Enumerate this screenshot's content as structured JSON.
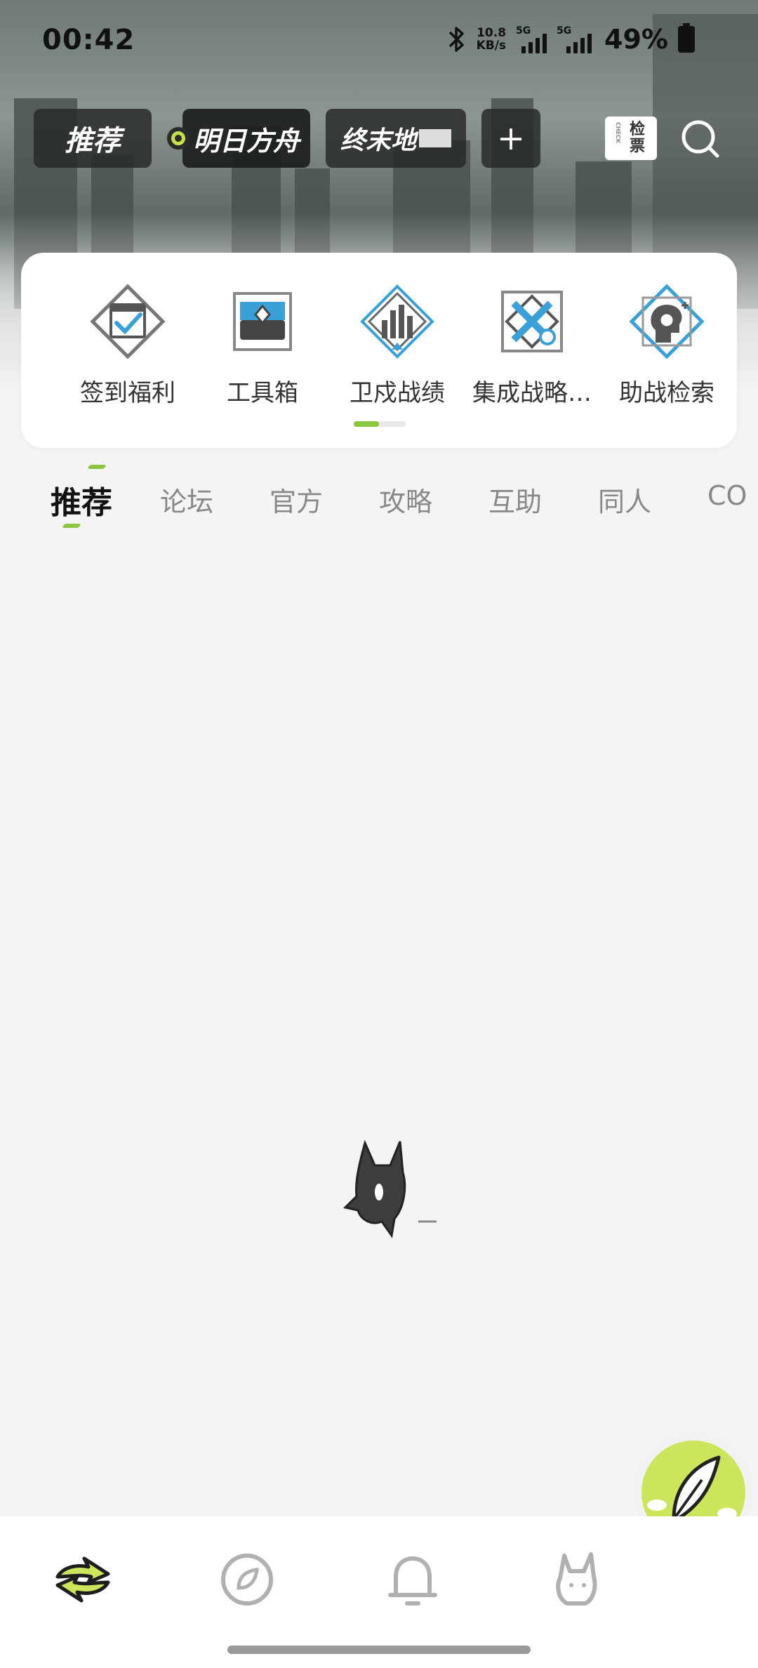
{
  "status_bar": {
    "time": "00:42",
    "net_speed_value": "10.8",
    "net_speed_unit": "KB/s",
    "sim1_tag": "5G",
    "sim2_tag": "5G",
    "battery_percent": "49%"
  },
  "game_tabs": {
    "recommend": "推荐",
    "arknights": "明日方舟",
    "endfield": "终末地",
    "add": "+"
  },
  "ticket": {
    "side_text": "CHECK",
    "label": "检票"
  },
  "tools": [
    {
      "label": "签到福利",
      "icon": "checkin-icon"
    },
    {
      "label": "工具箱",
      "icon": "toolbox-icon"
    },
    {
      "label": "卫戍战绩",
      "icon": "stats-icon"
    },
    {
      "label": "集成战略…",
      "icon": "strategy-icon"
    },
    {
      "label": "助战检索",
      "icon": "support-search-icon"
    }
  ],
  "categories": [
    "推荐",
    "论坛",
    "官方",
    "攻略",
    "互助",
    "同人",
    "CO"
  ],
  "colors": {
    "accent": "#8bc63f",
    "compose_bg": "#cbe65a",
    "tool_blue": "#3aa0d8",
    "tool_gray": "#6a6a6a"
  },
  "bottom_nav": [
    "home-icon",
    "discover-icon",
    "bell-icon",
    "profile-icon"
  ]
}
